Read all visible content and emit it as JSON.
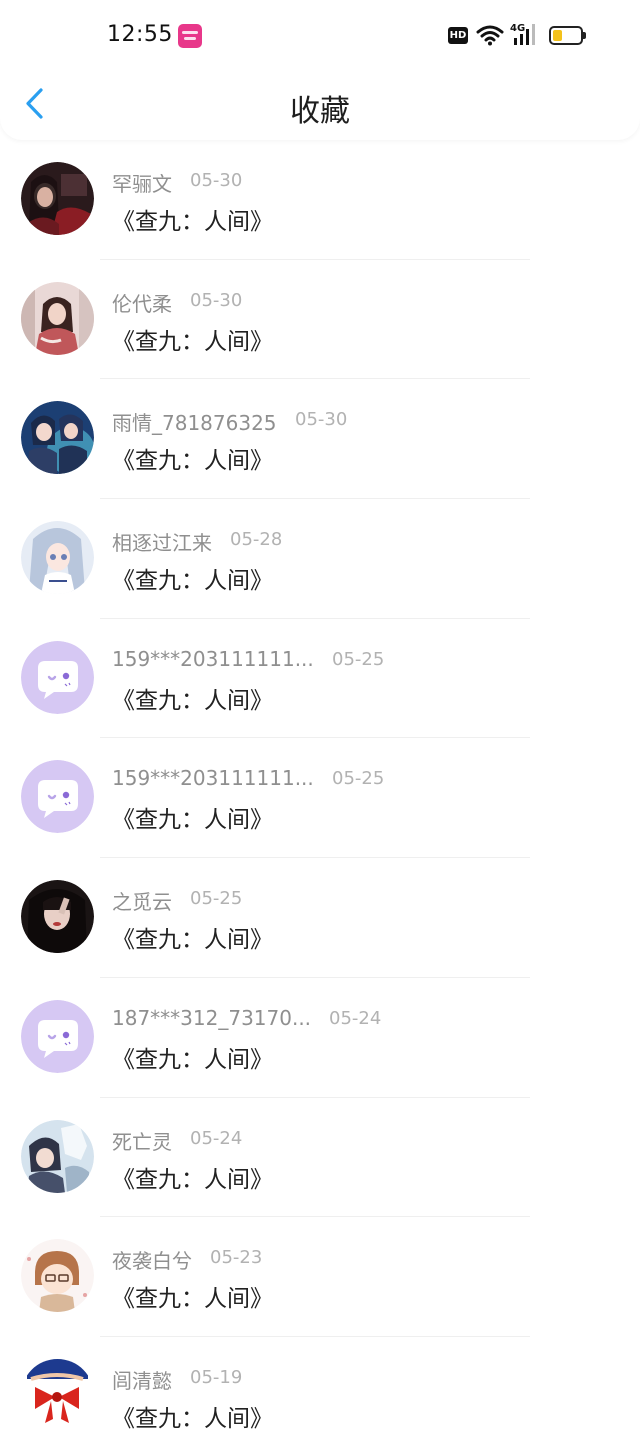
{
  "status_bar": {
    "time": "12:55",
    "hd_label": "HD",
    "network_label": "4G",
    "battery_level": 0.35,
    "battery_color": "#f4c21a",
    "icons": [
      "app-badge-icon",
      "hd-icon",
      "wifi-icon",
      "signal-icon",
      "battery-icon"
    ]
  },
  "header": {
    "title": "收藏",
    "back_icon": "chevron-left-icon",
    "accent_color": "#2a9ff0"
  },
  "items": [
    {
      "name": "罕骊文",
      "date": "05-30",
      "book": "《查九：人间》",
      "avatar": "photo-dark-red"
    },
    {
      "name": "伦代柔",
      "date": "05-30",
      "book": "《查九：人间》",
      "avatar": "photo-pink-girl"
    },
    {
      "name": "雨情_781876325",
      "date": "05-30",
      "book": "《查九：人间》",
      "avatar": "photo-anime-blue"
    },
    {
      "name": "相逐过江来",
      "date": "05-28",
      "book": "《查九：人间》",
      "avatar": "photo-anime-silver"
    },
    {
      "name": "159***203111111...",
      "date": "05-25",
      "book": "《查九：人间》",
      "avatar": "default-chat"
    },
    {
      "name": "159***203111111...",
      "date": "05-25",
      "book": "《查九：人间》",
      "avatar": "default-chat"
    },
    {
      "name": "之觅云",
      "date": "05-25",
      "book": "《查九：人间》",
      "avatar": "photo-dark-girl"
    },
    {
      "name": "187***312_73170...",
      "date": "05-24",
      "book": "《查九：人间》",
      "avatar": "default-chat"
    },
    {
      "name": "死亡灵",
      "date": "05-24",
      "book": "《查九：人间》",
      "avatar": "photo-anime-wolf"
    },
    {
      "name": "夜袭白兮",
      "date": "05-23",
      "book": "《查九：人间》",
      "avatar": "photo-chibi"
    },
    {
      "name": "闾清懿",
      "date": "05-19",
      "book": "《查九：人间》",
      "avatar": "photo-bow"
    }
  ]
}
